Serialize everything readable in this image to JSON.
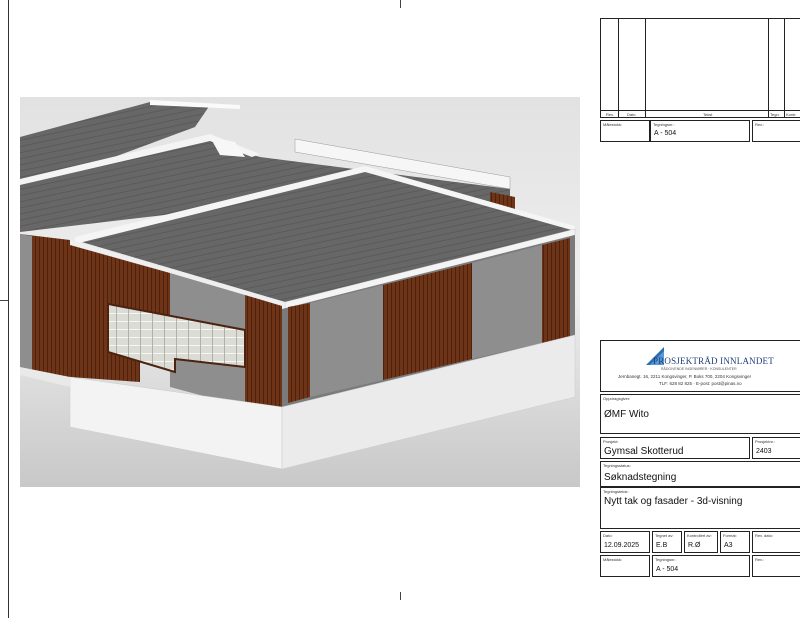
{
  "revision_table": {
    "headers": [
      "Rev.",
      "Dato",
      "Tekst",
      "Tegn.",
      "Kontr."
    ]
  },
  "title_block_top": {
    "maalestokk_label": "Målestokk:",
    "tegningsnr_label": "Tegningsnr.:",
    "tegningsnr_value": "A - 504",
    "rev_label": "Rev.:"
  },
  "company": {
    "name": "PROSJEKTRÅD INNLANDET",
    "tagline": "RÅDGIVENDE INGENIØRER · KONSULENTER",
    "address": "Jernbanegt. 16, 2211 Kongsvinger, P. Boks 700, 2204 Kongsvinger",
    "contact": "TLF: 628 82 825 · E-post: post@pinas.no"
  },
  "oppdragsgiver": {
    "label": "Oppdragsgiver:",
    "value": "ØMF Wito"
  },
  "prosjekt": {
    "label": "Prosjekt:",
    "value": "Gymsal Skotterud",
    "nr_label": "Prosjektnr.:",
    "nr_value": "2403"
  },
  "tegningsstatus": {
    "label": "Tegningsstatus:",
    "value": "Søknadstegning"
  },
  "tegningstekst": {
    "label": "Tegningstekst:",
    "value": "Nytt tak og fasader - 3d-visning"
  },
  "dates": {
    "dato_label": "Dato:",
    "dato_value": "12.09.2025",
    "tegnet_label": "Tegnet av:",
    "tegnet_value": "E.B",
    "kontrollert_label": "Kontrollert av:",
    "kontrollert_value": "R.Ø",
    "format_label": "Format:",
    "format_value": "A3",
    "revdato_label": "Rev. dato:"
  },
  "title_block_bottom": {
    "maalestokk_label": "Målestokk:",
    "tegningsnr_label": "Tegningsnr.:",
    "tegningsnr_value": "A - 504",
    "rev_label": "Rev.:"
  },
  "colors": {
    "wood": "#6e3417",
    "roof": "#666666",
    "panel": "#8e8e8e",
    "base": "#f2f2f2",
    "logo_blue": "#2a6fb5"
  }
}
